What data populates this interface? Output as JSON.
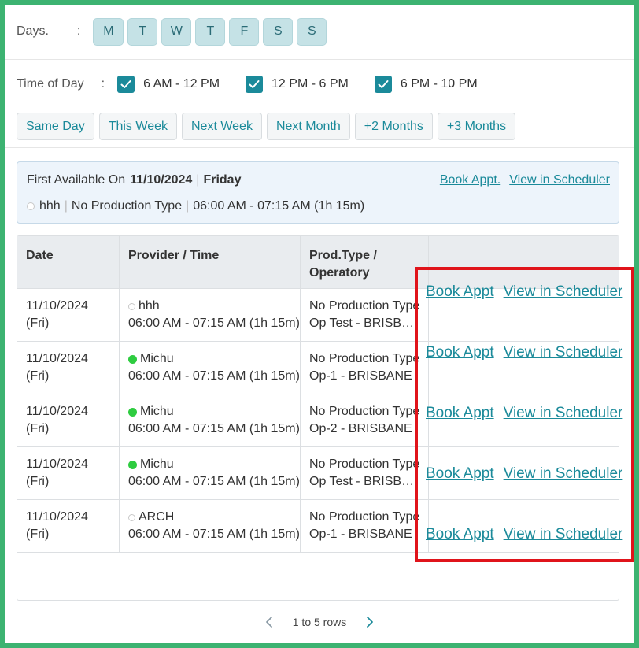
{
  "filters": {
    "days_label": "Days.",
    "days_colon": ":",
    "days": [
      "M",
      "T",
      "W",
      "T",
      "F",
      "S",
      "S"
    ],
    "time_label": "Time of Day",
    "time_colon": ":",
    "time_slots": [
      {
        "label": "6 AM - 12 PM",
        "checked": true
      },
      {
        "label": "12 PM - 6 PM",
        "checked": true
      },
      {
        "label": "6 PM - 10 PM",
        "checked": true
      }
    ],
    "ranges": [
      "Same Day",
      "This Week",
      "Next Week",
      "Next Month",
      "+2 Months",
      "+3 Months"
    ]
  },
  "first_available": {
    "prefix": "First Available On",
    "date": "11/10/2024",
    "sep": "|",
    "day": "Friday",
    "book_link": "Book Appt.",
    "view_link": "View in Scheduler",
    "provider": "hhh",
    "prod_type": "No Production Type",
    "time": "06:00 AM - 07:15 AM (1h 15m)"
  },
  "table": {
    "headers": {
      "date": "Date",
      "provider": "Provider / Time",
      "prod_line1": "Prod.Type /",
      "prod_line2": "Operatory"
    },
    "rows": [
      {
        "date": "11/10/2024",
        "dow": "(Fri)",
        "provider": "hhh",
        "status": "none",
        "time": "06:00 AM - 07:15 AM (1h 15m)",
        "prod": "No Production Type",
        "op": "Op Test - BRISBANE",
        "book": "Book Appt",
        "view": "View in Scheduler"
      },
      {
        "date": "11/10/2024",
        "dow": "(Fri)",
        "provider": "Michu",
        "status": "online",
        "time": "06:00 AM - 07:15 AM (1h 15m)",
        "prod": "No Production Type",
        "op": "Op-1 - BRISBANE",
        "book": "Book Appt",
        "view": "View in Scheduler"
      },
      {
        "date": "11/10/2024",
        "dow": "(Fri)",
        "provider": "Michu",
        "status": "online",
        "time": "06:00 AM - 07:15 AM (1h 15m)",
        "prod": "No Production Type",
        "op": "Op-2 - BRISBANE",
        "book": "Book Appt",
        "view": "View in Scheduler"
      },
      {
        "date": "11/10/2024",
        "dow": "(Fri)",
        "provider": "Michu",
        "status": "online",
        "time": "06:00 AM - 07:15 AM (1h 15m)",
        "prod": "No Production Type",
        "op": "Op Test - BRISBANE",
        "book": "Book Appt",
        "view": "View in Scheduler"
      },
      {
        "date": "11/10/2024",
        "dow": "(Fri)",
        "provider": "ARCH",
        "status": "none",
        "time": "06:00 AM - 07:15 AM (1h 15m)",
        "prod": "No Production Type",
        "op": "Op-1 - BRISBANE",
        "book": "Book Appt",
        "view": "View in Scheduler"
      }
    ]
  },
  "pager": {
    "text": "1 to 5 rows"
  },
  "colors": {
    "accent": "#1b8a9a",
    "frame": "#3cb371",
    "highlight": "#e0141b",
    "online": "#2ecc40"
  }
}
